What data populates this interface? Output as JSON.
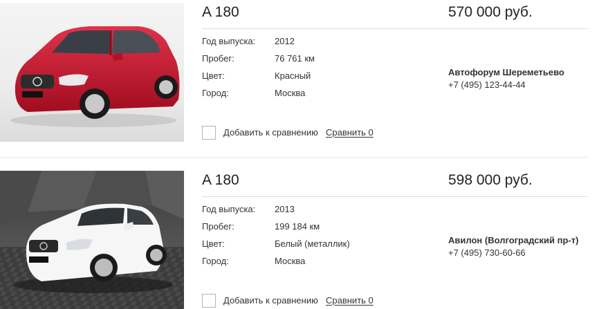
{
  "listings": [
    {
      "title": "A 180",
      "price": "570 000 руб.",
      "specs": [
        {
          "label": "Год выпуска:",
          "value": "2012"
        },
        {
          "label": "Пробег:",
          "value": "76 761 км"
        },
        {
          "label": "Цвет:",
          "value": "Красный"
        },
        {
          "label": "Город:",
          "value": "Москва"
        }
      ],
      "dealer": {
        "name": "Автофорум Шереметьево",
        "phone": "+7 (495) 123-44-44"
      },
      "compare": {
        "label": "Добавить к сравнению",
        "link": "Сравнить 0"
      },
      "car_color": "#c8142a"
    },
    {
      "title": "A 180",
      "price": "598 000 руб.",
      "specs": [
        {
          "label": "Год выпуска:",
          "value": "2013"
        },
        {
          "label": "Пробег:",
          "value": "199 184 км"
        },
        {
          "label": "Цвет:",
          "value": "Белый (металлик)"
        },
        {
          "label": "Город:",
          "value": "Москва"
        }
      ],
      "dealer": {
        "name": "Авилон (Волгоградский пр-т)",
        "phone": "+7 (495) 730-60-66"
      },
      "compare": {
        "label": "Добавить к сравнению",
        "link": "Сравнить 0"
      },
      "car_color": "#f4f4f4"
    }
  ]
}
